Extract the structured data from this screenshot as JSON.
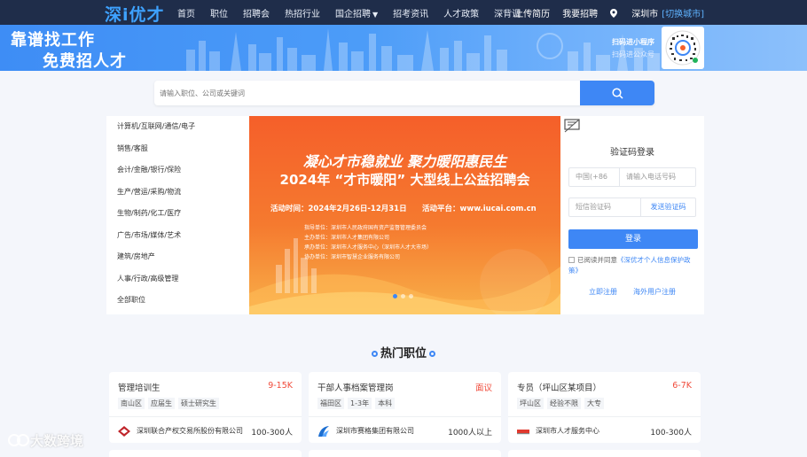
{
  "brand": {
    "logo": "深i优才"
  },
  "nav": {
    "items": [
      {
        "label": "首页",
        "caret": false
      },
      {
        "label": "职位",
        "caret": false
      },
      {
        "label": "招聘会",
        "caret": false
      },
      {
        "label": "热招行业",
        "caret": false
      },
      {
        "label": "国企招聘",
        "caret": true
      },
      {
        "label": "招考资讯",
        "caret": false
      },
      {
        "label": "人才政策",
        "caret": false
      },
      {
        "label": "深背调",
        "caret": false
      }
    ],
    "upload_resume": "上传简历",
    "want_hire": "我要招聘",
    "city": "深圳市",
    "switch_city": "[切换城市]"
  },
  "banner": {
    "slogan_line1": "靠谱找工作",
    "slogan_line2": "免费招人才",
    "qr_title": "扫码进小程序",
    "qr_subtitle": "扫码进公众号"
  },
  "search": {
    "placeholder": "请输入职位、公司或关键词"
  },
  "categories": [
    "计算机/互联网/通信/电子",
    "销售/客服",
    "会计/金融/银行/保险",
    "生产/营运/采购/物流",
    "生物/制药/化工/医疗",
    "广告/市场/媒体/艺术",
    "建筑/房地产",
    "人事/行政/高级管理",
    "全部职位"
  ],
  "hero": {
    "title1": "凝心才市稳就业 聚力暖阳惠民生",
    "title2": "2024年 “才市暖阳” 大型线上公益招聘会",
    "time": "活动时间：2024年2月26日-12月31日",
    "platform": "活动平台：www.iucai.com.cn",
    "orgs": [
      "指导单位：深圳市人民政府国有资产监督管理委员会",
      "主办单位：深圳市人才集团有限公司",
      "承办单位：深圳市人才服务中心（深圳市人才大市场）",
      "协办单位：深圳市智慧企业服务有限公司"
    ]
  },
  "login": {
    "title": "验证码登录",
    "country_code": "中国(+86",
    "phone_placeholder": "请输入电话号码",
    "code_placeholder": "短信验证码",
    "send_code": "发送验证码",
    "login_button": "登录",
    "agree_text": "已阅读并同意",
    "agree_link": "《深优才个人信息保护政策》",
    "register": "立即注册",
    "overseas": "海外用户注册"
  },
  "section": {
    "hot_jobs": "热门职位"
  },
  "jobs": [
    {
      "title": "管理培训生",
      "salary": "9-15K",
      "tags": [
        "南山区",
        "应届生",
        "硕士研究生"
      ],
      "company": "深圳联合产权交易所股份有限公司",
      "size": "100-300人"
    },
    {
      "title": "干部人事档案管理岗",
      "salary": "面议",
      "tags": [
        "福田区",
        "1-3年",
        "本科"
      ],
      "company": "深圳市赛格集团有限公司",
      "size": "1000人以上"
    },
    {
      "title": "专员（坪山区某项目）",
      "salary": "6-7K",
      "tags": [
        "坪山区",
        "经验不限",
        "大专"
      ],
      "company": "深圳市人才服务中心",
      "size": "100-300人"
    }
  ],
  "watermark": "大数跨境",
  "colors": {
    "primary": "#3e87f5",
    "nav_bg": "#1f2d4a",
    "salary": "#f04a3a",
    "hero": "#f55f2a"
  }
}
